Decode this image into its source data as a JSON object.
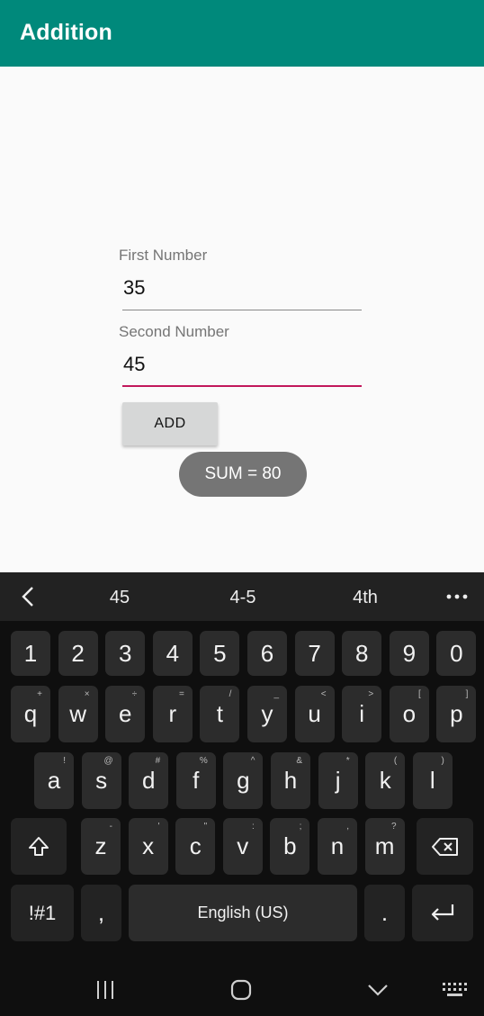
{
  "app": {
    "title": "Addition"
  },
  "form": {
    "first_label": "First Number",
    "first_value": "35",
    "second_label": "Second Number",
    "second_value": "45",
    "add_label": "ADD",
    "toast": "SUM = 80"
  },
  "keyboard": {
    "suggestions": [
      "45",
      "4-5",
      "4th"
    ],
    "row_numbers": [
      "1",
      "2",
      "3",
      "4",
      "5",
      "6",
      "7",
      "8",
      "9",
      "0"
    ],
    "row1": [
      {
        "k": "q",
        "s": "+"
      },
      {
        "k": "w",
        "s": "×"
      },
      {
        "k": "e",
        "s": "÷"
      },
      {
        "k": "r",
        "s": "="
      },
      {
        "k": "t",
        "s": "/"
      },
      {
        "k": "y",
        "s": "_"
      },
      {
        "k": "u",
        "s": "<"
      },
      {
        "k": "i",
        "s": ">"
      },
      {
        "k": "o",
        "s": "["
      },
      {
        "k": "p",
        "s": "]"
      }
    ],
    "row2": [
      {
        "k": "a",
        "s": "!"
      },
      {
        "k": "s",
        "s": "@"
      },
      {
        "k": "d",
        "s": "#"
      },
      {
        "k": "f",
        "s": "%"
      },
      {
        "k": "g",
        "s": "^"
      },
      {
        "k": "h",
        "s": "&"
      },
      {
        "k": "j",
        "s": "*"
      },
      {
        "k": "k",
        "s": "("
      },
      {
        "k": "l",
        "s": ")"
      }
    ],
    "row3": [
      {
        "k": "z",
        "s": "-"
      },
      {
        "k": "x",
        "s": "'"
      },
      {
        "k": "c",
        "s": "\""
      },
      {
        "k": "v",
        "s": ":"
      },
      {
        "k": "b",
        "s": ";"
      },
      {
        "k": "n",
        "s": ","
      },
      {
        "k": "m",
        "s": "?"
      }
    ],
    "symbols_label": "!#1",
    "comma": ",",
    "space_label": "English (US)",
    "period": "."
  },
  "colors": {
    "appbar": "#00897b",
    "accent": "#c2185b"
  },
  "icons": {
    "suggest_back": "chevron-left-icon",
    "suggest_more": "more-horizontal-icon",
    "shift": "shift-icon",
    "backspace": "backspace-icon",
    "enter": "enter-icon",
    "nav_recents": "recents-icon",
    "nav_home": "home-icon",
    "nav_back": "hide-keyboard-icon",
    "nav_keyboard": "keyboard-icon"
  }
}
